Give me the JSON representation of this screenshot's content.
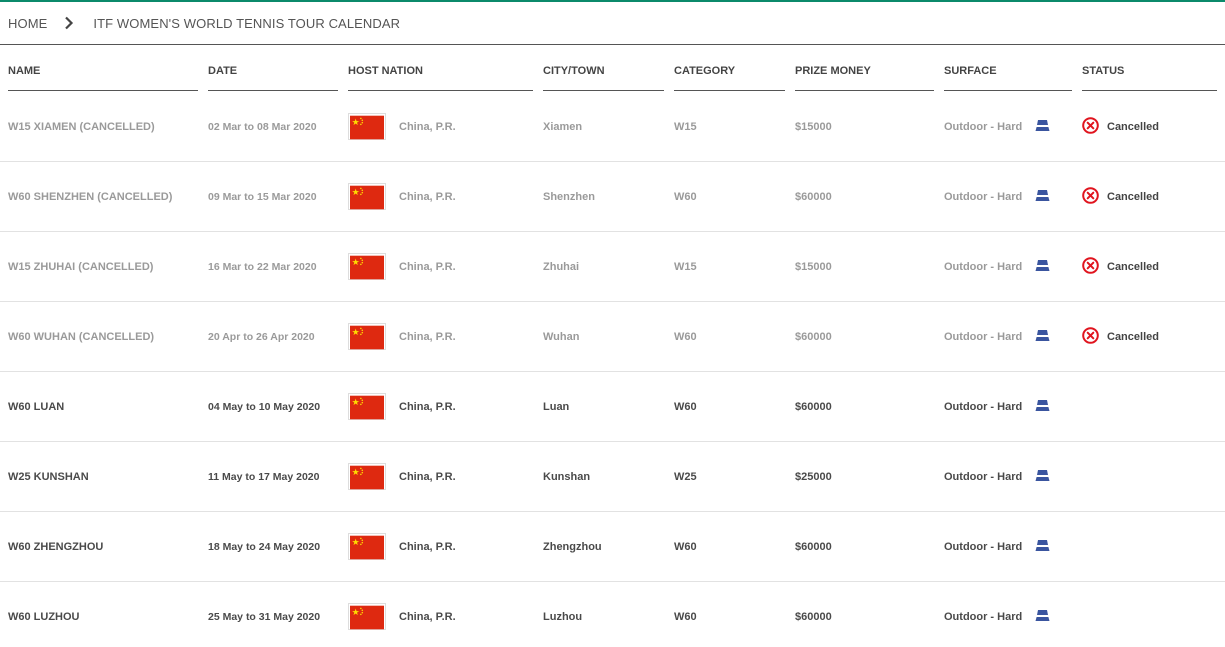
{
  "colors": {
    "accent_top_border": "#0b8a6b",
    "surface_icon": "#3a559f",
    "cancelled_icon": "#e0141e",
    "flag_red": "#de2910",
    "flag_star": "#ffde00"
  },
  "breadcrumb": {
    "home": "HOME",
    "separator_icon": "chevron-right-icon",
    "current": "ITF WOMEN'S WORLD TENNIS TOUR CALENDAR"
  },
  "table": {
    "headers": {
      "name": "NAME",
      "date": "DATE",
      "host_nation": "HOST NATION",
      "city": "CITY/TOWN",
      "category": "CATEGORY",
      "prize_money": "PRIZE MONEY",
      "surface": "SURFACE",
      "status": "STATUS"
    },
    "rows": [
      {
        "name": "W15 XIAMEN (CANCELLED)",
        "date": "02 Mar to 08 Mar 2020",
        "flag_icon": "china-flag-icon",
        "host_nation": "China, P.R.",
        "city": "Xiamen",
        "category": "W15",
        "prize_money": "$15000",
        "surface": "Outdoor - Hard",
        "surface_icon": "hard-court-icon",
        "status": "Cancelled",
        "status_icon": "cancelled-x-icon"
      },
      {
        "name": "W60 SHENZHEN (CANCELLED)",
        "date": "09 Mar to 15 Mar 2020",
        "flag_icon": "china-flag-icon",
        "host_nation": "China, P.R.",
        "city": "Shenzhen",
        "category": "W60",
        "prize_money": "$60000",
        "surface": "Outdoor - Hard",
        "surface_icon": "hard-court-icon",
        "status": "Cancelled",
        "status_icon": "cancelled-x-icon"
      },
      {
        "name": "W15 ZHUHAI (CANCELLED)",
        "date": "16 Mar to 22 Mar 2020",
        "flag_icon": "china-flag-icon",
        "host_nation": "China, P.R.",
        "city": "Zhuhai",
        "category": "W15",
        "prize_money": "$15000",
        "surface": "Outdoor - Hard",
        "surface_icon": "hard-court-icon",
        "status": "Cancelled",
        "status_icon": "cancelled-x-icon"
      },
      {
        "name": "W60 WUHAN (CANCELLED)",
        "date": "20 Apr to 26 Apr 2020",
        "flag_icon": "china-flag-icon",
        "host_nation": "China, P.R.",
        "city": "Wuhan",
        "category": "W60",
        "prize_money": "$60000",
        "surface": "Outdoor - Hard",
        "surface_icon": "hard-court-icon",
        "status": "Cancelled",
        "status_icon": "cancelled-x-icon"
      },
      {
        "name": "W60 LUAN",
        "date": "04 May to 10 May 2020",
        "flag_icon": "china-flag-icon",
        "host_nation": "China, P.R.",
        "city": "Luan",
        "category": "W60",
        "prize_money": "$60000",
        "surface": "Outdoor - Hard",
        "surface_icon": "hard-court-icon",
        "status": "",
        "status_icon": ""
      },
      {
        "name": "W25 KUNSHAN",
        "date": "11 May to 17 May 2020",
        "flag_icon": "china-flag-icon",
        "host_nation": "China, P.R.",
        "city": "Kunshan",
        "category": "W25",
        "prize_money": "$25000",
        "surface": "Outdoor - Hard",
        "surface_icon": "hard-court-icon",
        "status": "",
        "status_icon": ""
      },
      {
        "name": "W60 ZHENGZHOU",
        "date": "18 May to 24 May 2020",
        "flag_icon": "china-flag-icon",
        "host_nation": "China, P.R.",
        "city": "Zhengzhou",
        "category": "W60",
        "prize_money": "$60000",
        "surface": "Outdoor - Hard",
        "surface_icon": "hard-court-icon",
        "status": "",
        "status_icon": ""
      },
      {
        "name": "W60 LUZHOU",
        "date": "25 May to 31 May 2020",
        "flag_icon": "china-flag-icon",
        "host_nation": "China, P.R.",
        "city": "Luzhou",
        "category": "W60",
        "prize_money": "$60000",
        "surface": "Outdoor - Hard",
        "surface_icon": "hard-court-icon",
        "status": "",
        "status_icon": ""
      }
    ]
  }
}
